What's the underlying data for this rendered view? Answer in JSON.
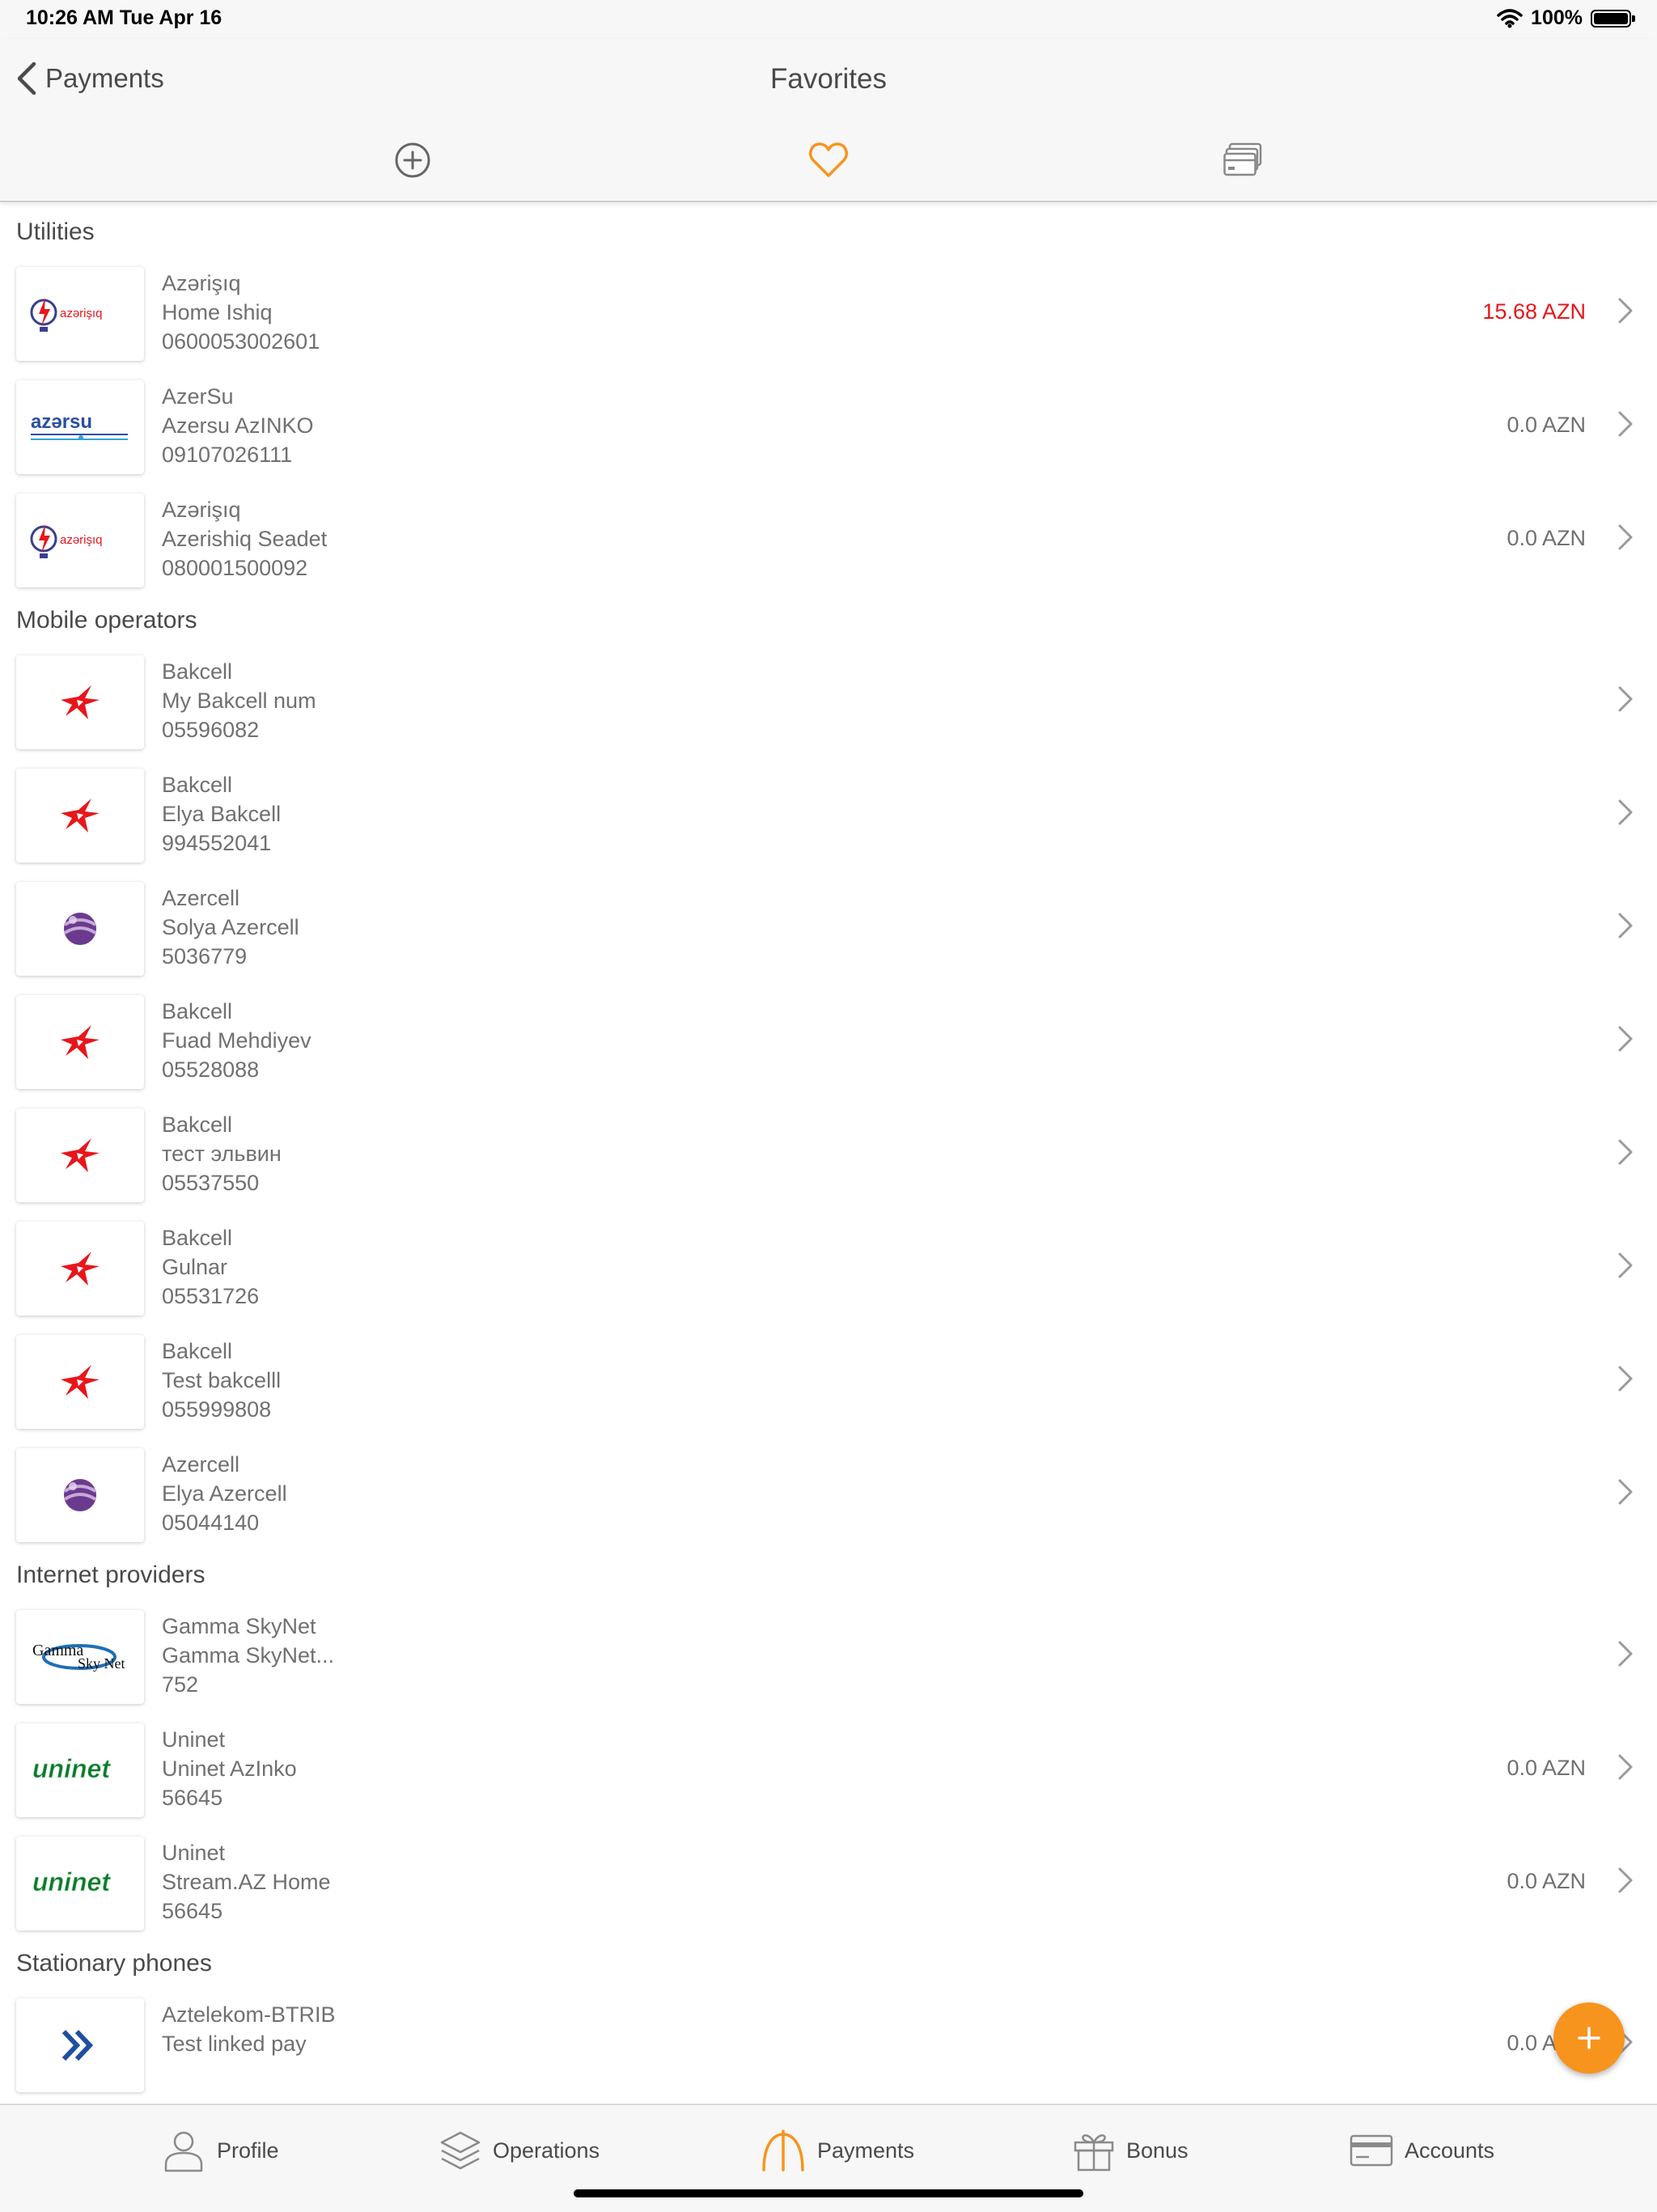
{
  "status_bar": {
    "time": "10:26 AM   Tue Apr 16",
    "battery": "100%"
  },
  "nav": {
    "back_label": "Payments",
    "title": "Favorites"
  },
  "sections": [
    {
      "title": "Utilities",
      "rows": [
        {
          "provider": "Azərişıq",
          "name": "Home Ishiq",
          "account": "0600053002601",
          "amount": "15.68 AZN",
          "logo": "azerishiq"
        },
        {
          "provider": "AzerSu",
          "name": "Azersu AzINKO",
          "account": "09107026111",
          "amount": "0.0 AZN",
          "logo": "azersu"
        },
        {
          "provider": "Azərişıq",
          "name": "Azerishiq Seadet",
          "account": "080001500092",
          "amount": "0.0 AZN",
          "logo": "azerishiq"
        }
      ]
    },
    {
      "title": "Mobile operators",
      "rows": [
        {
          "provider": "Bakcell",
          "name": "My Bakcell num",
          "account": "05596082",
          "amount": "",
          "logo": "bakcell"
        },
        {
          "provider": "Bakcell",
          "name": "Elya Bakcell",
          "account": "994552041",
          "amount": "",
          "logo": "bakcell"
        },
        {
          "provider": "Azercell",
          "name": "Solya Azercell",
          "account": "5036779",
          "amount": "",
          "logo": "azercell"
        },
        {
          "provider": "Bakcell",
          "name": "Fuad Mehdiyev",
          "account": "05528088",
          "amount": "",
          "logo": "bakcell"
        },
        {
          "provider": "Bakcell",
          "name": "тест эльвин",
          "account": "05537550",
          "amount": "",
          "logo": "bakcell"
        },
        {
          "provider": "Bakcell",
          "name": "Gulnar",
          "account": "05531726",
          "amount": "",
          "logo": "bakcell"
        },
        {
          "provider": "Bakcell",
          "name": "Test bakcelll",
          "account": "055999808",
          "amount": "",
          "logo": "bakcell"
        },
        {
          "provider": "Azercell",
          "name": "Elya Azercell",
          "account": "05044140",
          "amount": "",
          "logo": "azercell"
        }
      ]
    },
    {
      "title": "Internet providers",
      "rows": [
        {
          "provider": "Gamma SkyNet",
          "name": "Gamma SkyNet...",
          "account": "752",
          "amount": "",
          "logo": "gamma"
        },
        {
          "provider": "Uninet",
          "name": "Uninet AzInko",
          "account": "56645",
          "amount": "0.0 AZN",
          "logo": "uninet"
        },
        {
          "provider": "Uninet",
          "name": "Stream.AZ Home",
          "account": "56645",
          "amount": "0.0 AZN",
          "logo": "uninet"
        }
      ]
    },
    {
      "title": "Stationary phones",
      "rows": [
        {
          "provider": "Aztelekom-BTRIB",
          "name": "Test linked pay",
          "account": "",
          "amount": "0.0 AZN",
          "logo": "aztelekom"
        }
      ]
    }
  ],
  "logos": {
    "azerishiq": "azərişıq",
    "azersu": "azərsu",
    "uninet": "uninet",
    "gamma_top": "Gamma",
    "gamma_bottom": "Sky Net"
  },
  "tabs": [
    {
      "label": "Profile",
      "icon": "person-icon"
    },
    {
      "label": "Operations",
      "icon": "layers-icon"
    },
    {
      "label": "Payments",
      "icon": "payments-icon"
    },
    {
      "label": "Bonus",
      "icon": "gift-icon"
    },
    {
      "label": "Accounts",
      "icon": "card-icon"
    }
  ],
  "colors": {
    "accent": "#f7941d",
    "amount_due": "#e8161b",
    "text": "#4a4a4a",
    "subtext": "#707070"
  }
}
